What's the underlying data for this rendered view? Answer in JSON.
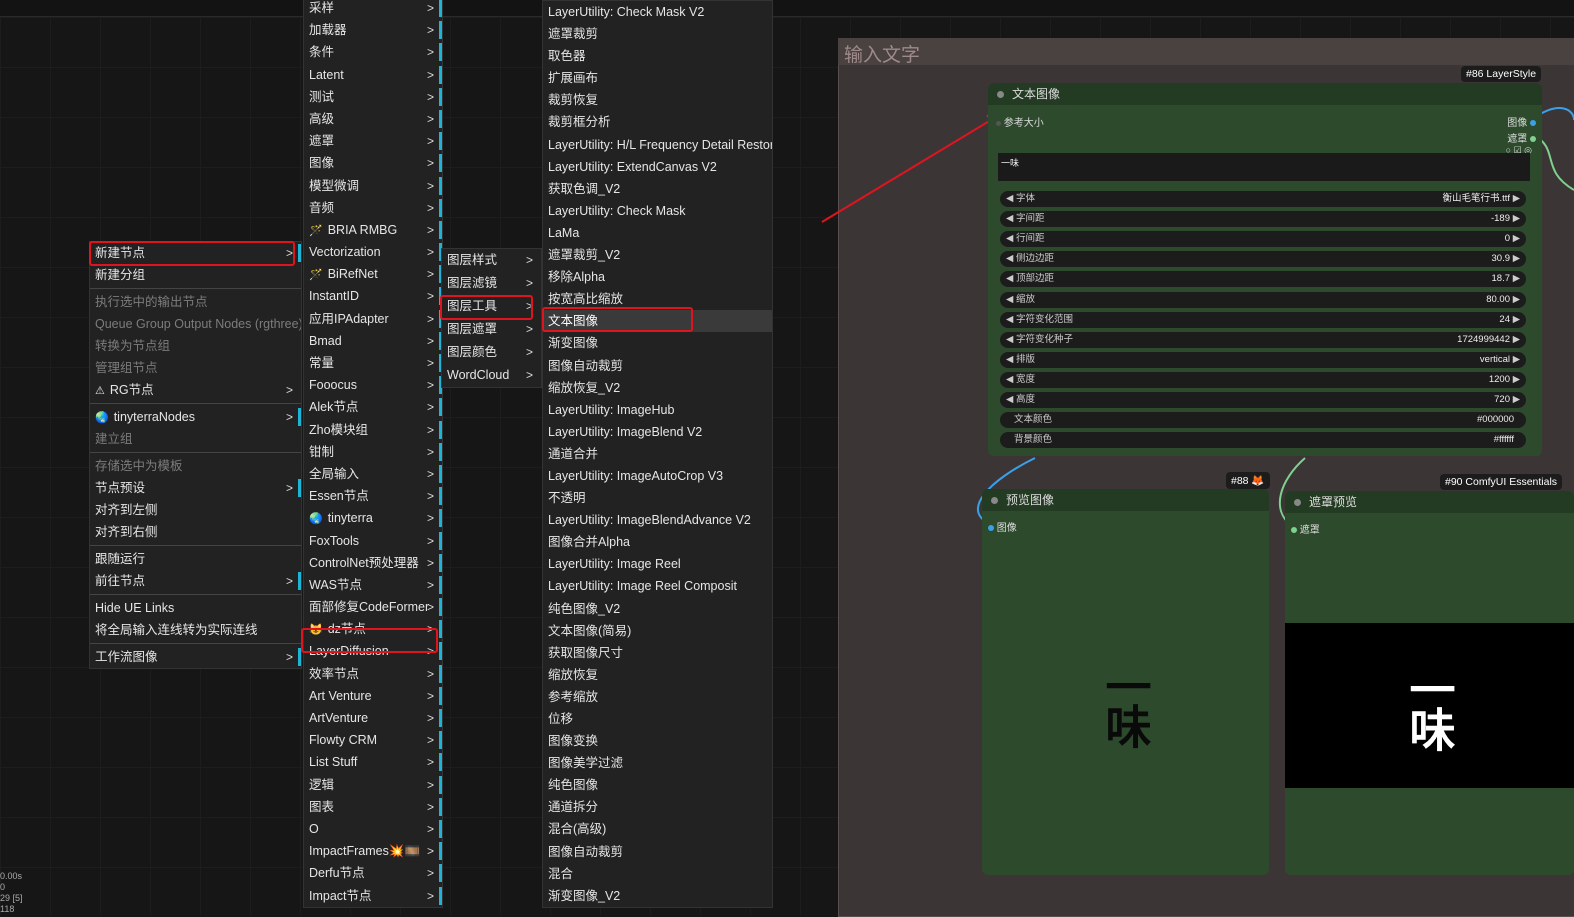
{
  "canvas_stats": [
    "0.00s",
    "0",
    "29 [5]",
    "118"
  ],
  "main_menu": {
    "items": [
      {
        "label": "新建节点",
        "disabled": false,
        "arrow": true,
        "bar": true
      },
      {
        "label": "新建分组",
        "disabled": false
      },
      {
        "sep": true
      },
      {
        "label": "执行选中的输出节点",
        "disabled": true
      },
      {
        "label": "Queue Group Output Nodes (rgthree)",
        "disabled": true
      },
      {
        "label": "转换为节点组",
        "disabled": true
      },
      {
        "label": "管理组节点",
        "disabled": true
      },
      {
        "label": "RG节点",
        "icon": "⚠",
        "arrow": true
      },
      {
        "sep": true
      },
      {
        "label": "tinyterraNodes",
        "icon": "🌏",
        "arrow": true,
        "bar": true
      },
      {
        "label": "建立组",
        "disabled": true
      },
      {
        "sep": true
      },
      {
        "label": "存储选中为模板",
        "disabled": true
      },
      {
        "label": "节点预设",
        "arrow": true,
        "bar": true
      },
      {
        "label": "对齐到左侧"
      },
      {
        "label": "对齐到右侧"
      },
      {
        "sep": true
      },
      {
        "label": "跟随运行"
      },
      {
        "label": "前往节点",
        "arrow": true,
        "bar": true
      },
      {
        "sep": true
      },
      {
        "label": "Hide UE Links"
      },
      {
        "label": "将全局输入连线转为实际连线"
      },
      {
        "sep": true
      },
      {
        "label": "工作流图像",
        "arrow": true,
        "bar": true
      }
    ]
  },
  "category_menu": {
    "items": [
      {
        "label": "采样"
      },
      {
        "label": "加载器"
      },
      {
        "label": "条件"
      },
      {
        "label": "Latent"
      },
      {
        "label": "测试"
      },
      {
        "label": "高级"
      },
      {
        "label": "遮罩"
      },
      {
        "label": "图像"
      },
      {
        "label": "模型微调"
      },
      {
        "label": "音频"
      },
      {
        "label": "BRIA RMBG",
        "icon": "🪄"
      },
      {
        "label": "Vectorization"
      },
      {
        "label": "BiRefNet",
        "icon": "🪄"
      },
      {
        "label": "InstantID"
      },
      {
        "label": "应用IPAdapter"
      },
      {
        "label": "Bmad"
      },
      {
        "label": "常量"
      },
      {
        "label": "Fooocus"
      },
      {
        "label": "Alek节点"
      },
      {
        "label": "Zho模块组"
      },
      {
        "label": "钳制"
      },
      {
        "label": "全局输入"
      },
      {
        "label": "Essen节点"
      },
      {
        "label": "tinyterra",
        "icon": "🌏"
      },
      {
        "label": "FoxTools"
      },
      {
        "label": "ControlNet预处理器"
      },
      {
        "label": "WAS节点"
      },
      {
        "label": "面部修复CodeFormer"
      },
      {
        "label": "dz节点",
        "icon": "😺"
      },
      {
        "label": "LayerDiffusion"
      },
      {
        "label": "效率节点"
      },
      {
        "label": "Art Venture"
      },
      {
        "label": "ArtVenture"
      },
      {
        "label": "Flowty CRM"
      },
      {
        "label": "List Stuff"
      },
      {
        "label": "逻辑"
      },
      {
        "label": "图表"
      },
      {
        "label": "O"
      },
      {
        "label": "ImpactFrames💥🎞️"
      },
      {
        "label": "Derfu节点"
      },
      {
        "label": "Impact节点"
      }
    ]
  },
  "dz_menu": {
    "items": [
      {
        "label": "图层样式"
      },
      {
        "label": "图层滤镜"
      },
      {
        "label": "图层工具"
      },
      {
        "label": "图层遮罩"
      },
      {
        "label": "图层颜色"
      },
      {
        "label": "WordCloud"
      }
    ]
  },
  "tools_menu": {
    "items": [
      "LayerUtility: Check Mask V2",
      "遮罩裁剪",
      "取色器",
      "扩展画布",
      "裁剪恢复",
      "裁剪框分析",
      "LayerUtility: H/L Frequency Detail Restore",
      "LayerUtility: ExtendCanvas V2",
      "获取色调_V2",
      "LayerUtility: Check Mask",
      "LaMa",
      "遮罩裁剪_V2",
      "移除Alpha",
      "按宽高比缩放",
      "文本图像",
      "渐变图像",
      "图像自动裁剪",
      "缩放恢复_V2",
      "LayerUtility: ImageHub",
      "LayerUtility: ImageBlend V2",
      "通道合并",
      "LayerUtility: ImageAutoCrop V3",
      "不透明",
      "LayerUtility: ImageBlendAdvance V2",
      "图像合并Alpha",
      "LayerUtility: Image Reel",
      "LayerUtility: Image Reel Composit",
      "纯色图像_V2",
      "文本图像(简易)",
      "获取图像尺寸",
      "缩放恢复",
      "参考缩放",
      "位移",
      "图像变换",
      "图像美学过滤",
      "纯色图像",
      "通道拆分",
      "混合(高级)",
      "图像自动裁剪",
      "混合",
      "渐变图像_V2"
    ],
    "selected_index": 14
  },
  "group": {
    "title": "输入文字"
  },
  "text_node": {
    "badge": "#86 LayerStyle",
    "title": "文本图像",
    "input_label": "参考大小",
    "outputs": [
      "图像",
      "遮罩"
    ],
    "text_value": "一味",
    "widgets": [
      {
        "name": "字体",
        "value": "衡山毛笔行书.ttf"
      },
      {
        "name": "字间距",
        "value": "-189"
      },
      {
        "name": "行间距",
        "value": "0"
      },
      {
        "name": "侧边边距",
        "value": "30.9"
      },
      {
        "name": "顶部边距",
        "value": "18.7"
      },
      {
        "name": "缩放",
        "value": "80.00"
      },
      {
        "name": "字符变化范围",
        "value": "24"
      },
      {
        "name": "字符变化种子",
        "value": "1724999442"
      },
      {
        "name": "排版",
        "value": "vertical"
      },
      {
        "name": "宽度",
        "value": "1200"
      },
      {
        "name": "高度",
        "value": "720"
      },
      {
        "name": "文本颜色",
        "value": "#000000",
        "plain": true
      },
      {
        "name": "背景颜色",
        "value": "#ffffff",
        "plain": true
      }
    ]
  },
  "preview_node": {
    "badge": "#88 🦊",
    "title": "预览图像",
    "input_label": "图像",
    "preview_text": "一味"
  },
  "mask_node": {
    "badge": "#90 ComfyUI Essentials",
    "title": "遮罩预览",
    "input_label": "遮罩",
    "preview_text": "一味"
  },
  "colors": {
    "accent_bar": "#1fb3d6",
    "highlight": "#e0141e",
    "node_body": "#2d4a2d"
  }
}
